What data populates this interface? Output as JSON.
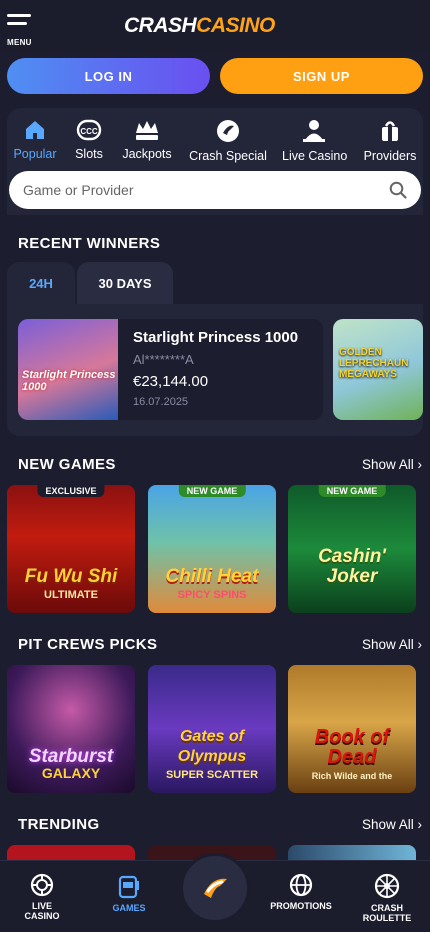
{
  "header": {
    "menu_label": "MENU",
    "logo_part1": "CRASH",
    "logo_part2": "CASINO"
  },
  "auth": {
    "login_label": "LOG IN",
    "signup_label": "SIGN UP"
  },
  "categories": [
    {
      "label": "Popular",
      "icon": "home-icon",
      "active": true
    },
    {
      "label": "Slots",
      "icon": "slot-machine-icon"
    },
    {
      "label": "Jackpots",
      "icon": "jackpot-crown-icon"
    },
    {
      "label": "Crash Special",
      "icon": "crash-logo-icon"
    },
    {
      "label": "Live Casino",
      "icon": "dealer-icon"
    },
    {
      "label": "Providers",
      "icon": "providers-icon"
    }
  ],
  "search": {
    "placeholder": "Game or Provider",
    "value": ""
  },
  "recent_winners": {
    "title": "RECENT WINNERS",
    "tabs": [
      "24H",
      "30 DAYS"
    ],
    "active_tab": "24H",
    "card": {
      "game": "Starlight Princess 1000",
      "thumb_text": "Starlight Princess 1000",
      "user": "Al********A",
      "amount": "€23,144.00",
      "date": "16.07.2025"
    },
    "next_card_text": "GOLDEN LEPRECHAUN MEGAWAYS"
  },
  "new_games": {
    "title": "NEW GAMES",
    "show_all": "Show All",
    "tiles": [
      {
        "name": "Fu Wu Shi",
        "sub": "ULTIMATE",
        "badge": "EXCLUSIVE"
      },
      {
        "name": "Chilli Heat",
        "sub": "SPICY SPINS",
        "badge": "NEW GAME"
      },
      {
        "name": "Cashin' Joker",
        "sub": "",
        "badge": "NEW GAME"
      }
    ]
  },
  "pit_crews": {
    "title": "PIT CREWS PICKS",
    "show_all": "Show All",
    "tiles": [
      {
        "name": "Starburst",
        "sub": "GALAXY"
      },
      {
        "name": "Gates of Olympus",
        "sub": "SUPER SCATTER"
      },
      {
        "name": "Book of Dead",
        "sub": "Rich Wilde and the"
      }
    ]
  },
  "trending": {
    "title": "TRENDING",
    "show_all": "Show All"
  },
  "bottom_nav": {
    "live_casino": "LIVE CASINO",
    "games": "GAMES",
    "promotions": "PROMOTIONS",
    "crash_roulette": "CRASH ROULETTE"
  },
  "colors": {
    "accent_orange": "#ff9f12",
    "accent_blue": "#59a8ff",
    "background": "#1c1d2e",
    "panel": "#232539"
  }
}
